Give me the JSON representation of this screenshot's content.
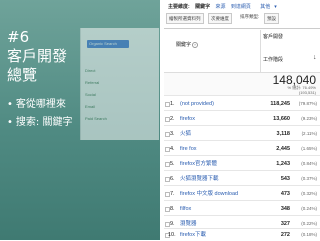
{
  "slide": {
    "title_lines": [
      "#6",
      "客戶開發",
      "總覽"
    ],
    "bullets": [
      "客從哪裡來",
      "搜索: 關鍵字"
    ],
    "bullet_mark": "•"
  },
  "thumbnail": {
    "selected_label": "Organic Search",
    "items": [
      "Direct",
      "Referral",
      "Social",
      "Email",
      "Paid Search"
    ]
  },
  "panel": {
    "dimension_row": {
      "label": "主要維度:",
      "current": "關鍵字",
      "links": [
        "來源",
        "到達網頁",
        "其他"
      ],
      "more_mark": "▾"
    },
    "toolbar": {
      "plot_rows": "繪製所選資料列",
      "secondary_dim": "次要維度",
      "sort_type": "排序類型:",
      "sort_value": "預設"
    },
    "table_header": {
      "keyword": "關鍵字",
      "help": "?",
      "metric_group": "客戶開發",
      "metric": "工作階段",
      "sort_arrow": "↓"
    },
    "totals": {
      "value": "148,040",
      "sub_line1": "% 總計: 76.49%",
      "sub_line2": "(193,531)"
    },
    "rows": [
      {
        "idx": "1.",
        "keyword": "(not provided)",
        "value": "118,245",
        "pct": "(79.87%)"
      },
      {
        "idx": "2.",
        "keyword": "firefox",
        "value": "13,660",
        "pct": "(9.23%)"
      },
      {
        "idx": "3.",
        "keyword": "火狐",
        "value": "3,118",
        "pct": "(2.11%)"
      },
      {
        "idx": "4.",
        "keyword": "fire fox",
        "value": "2,445",
        "pct": "(1.65%)"
      },
      {
        "idx": "5.",
        "keyword": "firefox官方繁體",
        "value": "1,243",
        "pct": "(0.84%)"
      },
      {
        "idx": "6.",
        "keyword": "火狐瀏覽器下載",
        "value": "543",
        "pct": "(0.37%)"
      },
      {
        "idx": "7.",
        "keyword": "firefox 中文版 download",
        "value": "473",
        "pct": "(0.32%)"
      },
      {
        "idx": "8.",
        "keyword": "filfox",
        "value": "348",
        "pct": "(0.24%)"
      },
      {
        "idx": "9.",
        "keyword": "瀏覽器",
        "value": "327",
        "pct": "(0.22%)"
      },
      {
        "idx": "10.",
        "keyword": "firefox下載",
        "value": "272",
        "pct": "(0.18%)"
      }
    ]
  }
}
